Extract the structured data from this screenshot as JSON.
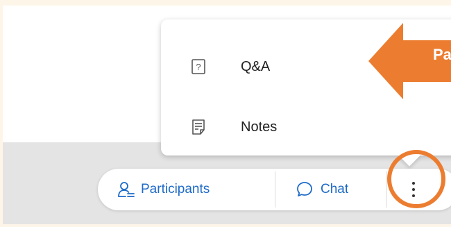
{
  "menu": {
    "items": [
      {
        "label": "Q&A",
        "icon": "question-box-icon"
      },
      {
        "label": "Notes",
        "icon": "notes-icon"
      }
    ]
  },
  "toolbar": {
    "participants_label": "Participants",
    "participants_icon": "participants-icon",
    "chat_label": "Chat",
    "chat_icon": "chat-bubble-icon",
    "more_icon": "more-vertical-icon"
  },
  "annotation": {
    "callout_text": "Pa",
    "color": "#ec7d30"
  },
  "colors": {
    "accent": "#1d6ac8",
    "background": "#fdf5e7",
    "annotation": "#ec7d30"
  }
}
